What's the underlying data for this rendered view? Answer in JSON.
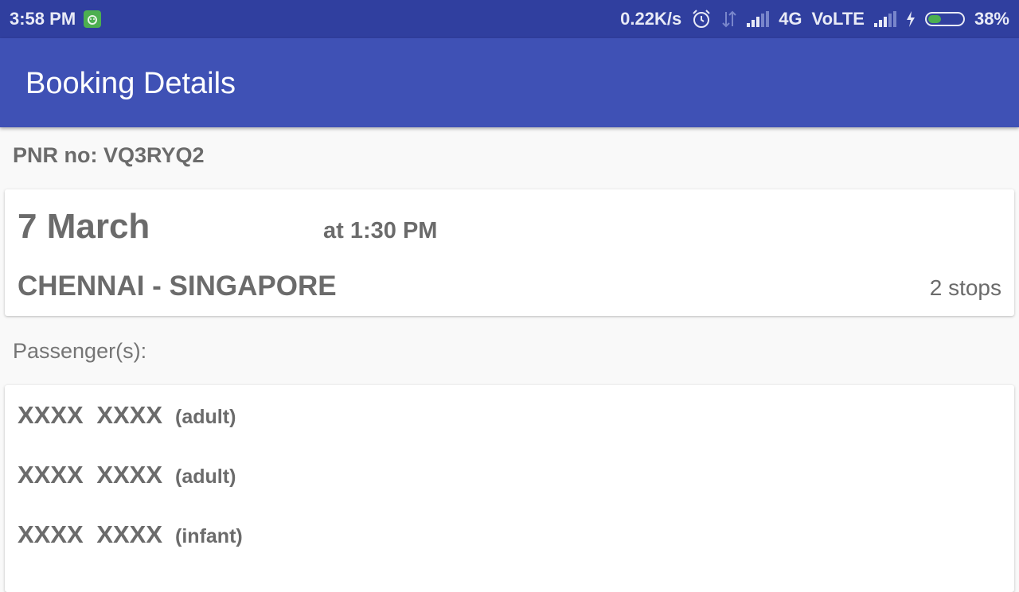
{
  "status_bar": {
    "time": "3:58 PM",
    "net_speed": "0.22K/s",
    "network": "4G",
    "volte": "VoLTE",
    "battery": "38%",
    "battery_level": 0.38,
    "icons": [
      "app-notification-icon",
      "alarm-icon",
      "data-arrows-icon",
      "signal-icon",
      "signal-icon",
      "charging-icon",
      "battery-icon"
    ]
  },
  "app_bar": {
    "title": "Booking Details",
    "color": "#3f51b5"
  },
  "pnr": "PNR no: VQ3RYQ2",
  "flight": {
    "date": "7 March",
    "time": "at 1:30 PM",
    "route": "CHENNAI - SINGAPORE",
    "stops": "2 stops"
  },
  "passengers_label": "Passenger(s):",
  "passengers": [
    {
      "name": "XXXX  XXXX",
      "type": "(adult)"
    },
    {
      "name": "XXXX  XXXX",
      "type": "(adult)"
    },
    {
      "name": "XXXX  XXXX",
      "type": "(infant)"
    }
  ]
}
